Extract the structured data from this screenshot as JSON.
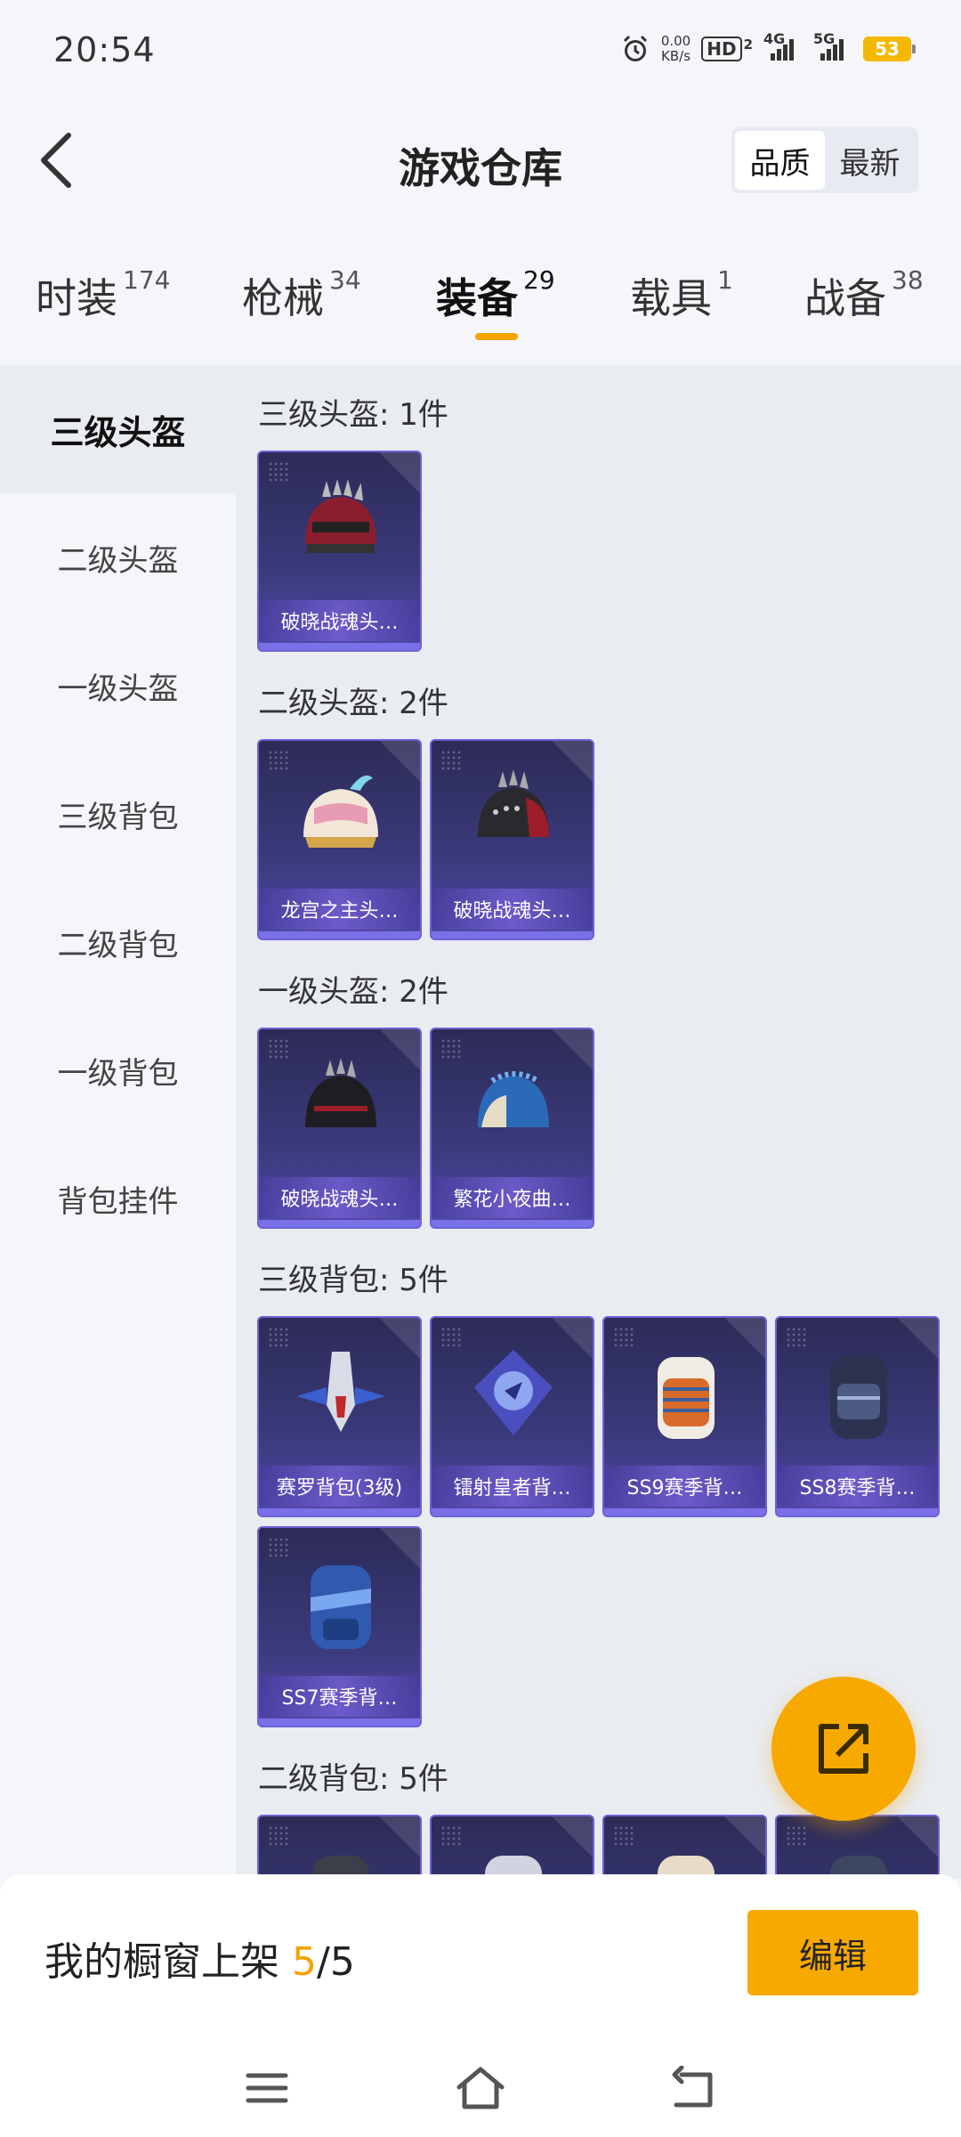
{
  "status_bar": {
    "time": "20:54",
    "net_speed_value": "0.00",
    "net_speed_unit": "KB/s",
    "hd_label": "HD",
    "hd_sub": "2",
    "signal_1": "4G",
    "signal_2": "5G",
    "battery": "53"
  },
  "header": {
    "title": "游戏仓库",
    "sort_options": [
      "品质",
      "最新"
    ],
    "active_sort": "品质"
  },
  "tabs": [
    {
      "label": "时装",
      "count": "174"
    },
    {
      "label": "枪械",
      "count": "34"
    },
    {
      "label": "装备",
      "count": "29"
    },
    {
      "label": "载具",
      "count": "1"
    },
    {
      "label": "战备",
      "count": "38"
    }
  ],
  "active_tab": "装备",
  "sidebar": {
    "items": [
      "三级头盔",
      "二级头盔",
      "一级头盔",
      "三级背包",
      "二级背包",
      "一级背包",
      "背包挂件"
    ],
    "active": "三级头盔"
  },
  "sections": [
    {
      "title": "三级头盔: 1件",
      "items": [
        {
          "name": "破晓战魂头…",
          "icon": "helmet-icon"
        }
      ]
    },
    {
      "title": "二级头盔: 2件",
      "items": [
        {
          "name": "龙宫之主头…",
          "icon": "helmet-icon"
        },
        {
          "name": "破晓战魂头…",
          "icon": "helmet-icon"
        }
      ]
    },
    {
      "title": "一级头盔: 2件",
      "items": [
        {
          "name": "破晓战魂头…",
          "icon": "helmet-icon"
        },
        {
          "name": "繁花小夜曲…",
          "icon": "helmet-icon"
        }
      ]
    },
    {
      "title": "三级背包: 5件",
      "items": [
        {
          "name": "赛罗背包(3级)",
          "icon": "backpack-icon"
        },
        {
          "name": "镭射皇者背…",
          "icon": "backpack-icon"
        },
        {
          "name": "SS9赛季背…",
          "icon": "backpack-icon"
        },
        {
          "name": "SS8赛季背…",
          "icon": "backpack-icon"
        },
        {
          "name": "SS7赛季背…",
          "icon": "backpack-icon"
        }
      ]
    },
    {
      "title": "二级背包: 5件",
      "items": [
        {
          "icon": "backpack-icon"
        },
        {
          "icon": "backpack-icon"
        },
        {
          "icon": "backpack-icon"
        },
        {
          "icon": "backpack-icon"
        }
      ]
    }
  ],
  "bottom_bar": {
    "showcase_label": "我的橱窗上架",
    "showcase_current": "5",
    "showcase_separator": "/",
    "showcase_total": "5",
    "edit_label": "编辑"
  },
  "colors": {
    "accent": "#f7a900",
    "card_border": "#6b63d6",
    "card_bg": "#3b3a7c"
  }
}
